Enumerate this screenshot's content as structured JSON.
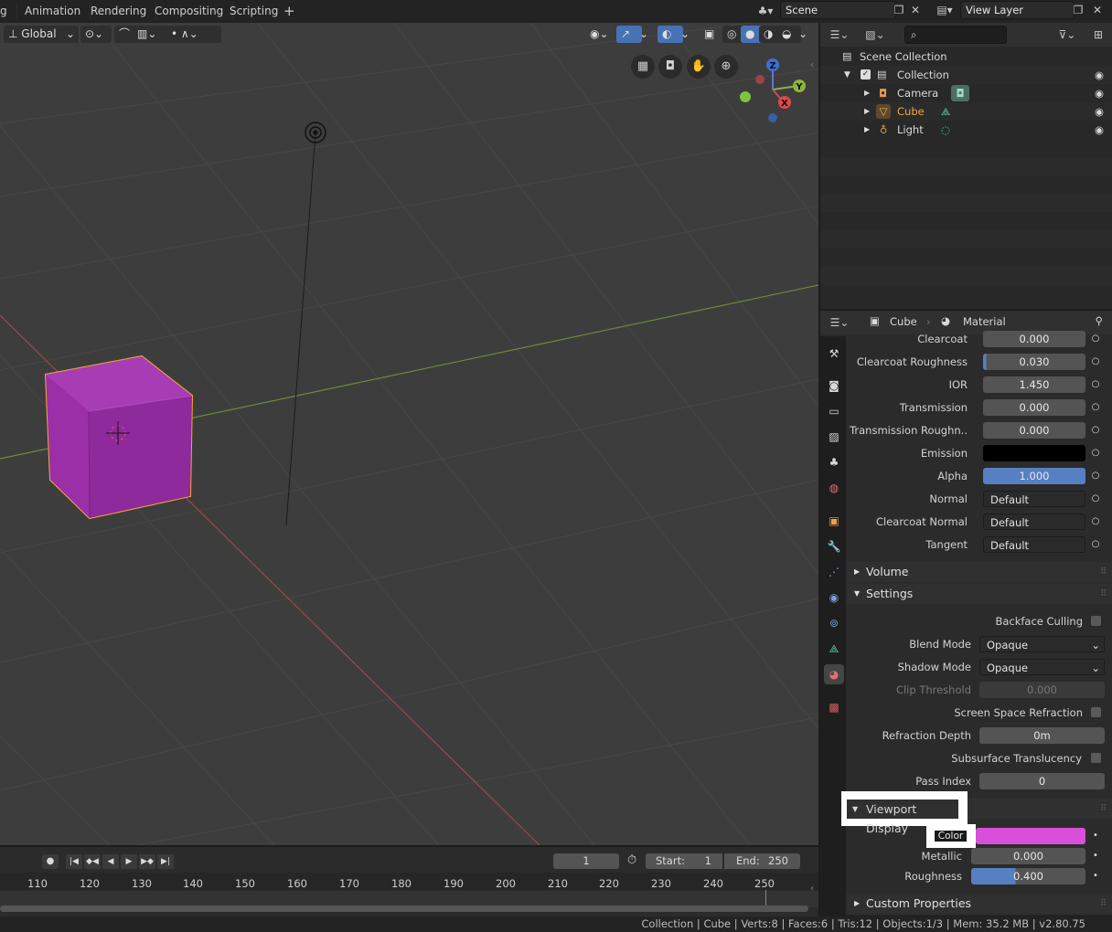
{
  "topbar": {
    "tabs": [
      "g",
      "Animation",
      "Rendering",
      "Compositing",
      "Scripting",
      "+"
    ],
    "scene": "Scene",
    "view_layer": "View Layer"
  },
  "viewport_header": {
    "orientation": "Global"
  },
  "gizmo": {
    "z": "Z",
    "y": "Y",
    "x": "X"
  },
  "timeline": {
    "current_frame": "1",
    "start_label": "Start:",
    "start_value": "1",
    "end_label": "End:",
    "end_value": "250",
    "ruler": [
      "110",
      "120",
      "130",
      "140",
      "150",
      "160",
      "170",
      "180",
      "190",
      "200",
      "210",
      "220",
      "230",
      "240",
      "250"
    ]
  },
  "outliner": {
    "scene_collection": "Scene Collection",
    "collection": "Collection",
    "items": [
      "Camera",
      "Cube",
      "Light"
    ]
  },
  "properties": {
    "breadcrumb_object": "Cube",
    "breadcrumb_tab": "Material",
    "rows": [
      {
        "label": "Clearcoat",
        "value": "0.000"
      },
      {
        "label": "Clearcoat Roughness",
        "value": "0.030"
      },
      {
        "label": "IOR",
        "value": "1.450"
      },
      {
        "label": "Transmission",
        "value": "0.000"
      },
      {
        "label": "Transmission Roughn..",
        "value": "0.000"
      },
      {
        "label": "Emission",
        "value": ""
      },
      {
        "label": "Alpha",
        "value": "1.000"
      },
      {
        "label": "Normal",
        "value": "Default"
      },
      {
        "label": "Clearcoat Normal",
        "value": "Default"
      },
      {
        "label": "Tangent",
        "value": "Default"
      }
    ],
    "volume": "Volume",
    "settings": "Settings",
    "backface_culling": "Backface Culling",
    "blend_mode_label": "Blend Mode",
    "blend_mode": "Opaque",
    "shadow_mode_label": "Shadow Mode",
    "shadow_mode": "Opaque",
    "clip_threshold_label": "Clip Threshold",
    "clip_threshold": "0.000",
    "ssr_label": "Screen Space Refraction",
    "refraction_depth_label": "Refraction Depth",
    "refraction_depth": "0m",
    "subsurface_label": "Subsurface Translucency",
    "pass_index_label": "Pass Index",
    "pass_index": "0",
    "viewport_display": "Viewport Display",
    "color_label": "Color",
    "metallic_label": "Metallic",
    "metallic": "0.000",
    "roughness_label": "Roughness",
    "roughness": "0.400",
    "custom_properties": "Custom Properties"
  },
  "colors": {
    "cube": "#9b2fa8",
    "selection_outline": "#f5a833",
    "viewport_color_swatch": "#d94fd9",
    "alpha_bar": "#5680c2"
  },
  "statusbar": "Collection | Cube | Verts:8 | Faces:6 | Tris:12 | Objects:1/3 | Mem: 35.2 MB | v2.80.75"
}
